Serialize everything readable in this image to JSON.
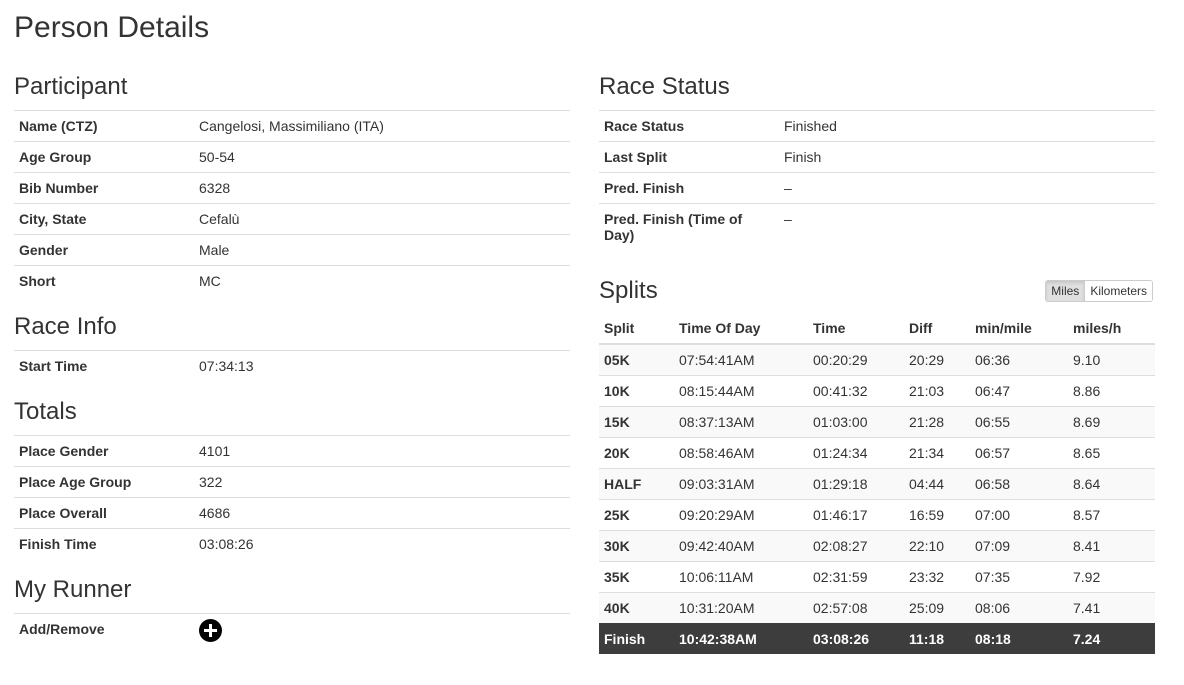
{
  "page_title": "Person Details",
  "participant": {
    "title": "Participant",
    "rows": [
      {
        "label": "Name (CTZ)",
        "value": "Cangelosi, Massimiliano (ITA)"
      },
      {
        "label": "Age Group",
        "value": "50-54"
      },
      {
        "label": "Bib Number",
        "value": "6328"
      },
      {
        "label": "City, State",
        "value": "Cefalù"
      },
      {
        "label": "Gender",
        "value": "Male"
      },
      {
        "label": "Short",
        "value": "MC"
      }
    ]
  },
  "race_info": {
    "title": "Race Info",
    "rows": [
      {
        "label": "Start Time",
        "value": "07:34:13"
      }
    ]
  },
  "totals": {
    "title": "Totals",
    "rows": [
      {
        "label": "Place Gender",
        "value": "4101"
      },
      {
        "label": "Place Age Group",
        "value": "322"
      },
      {
        "label": "Place Overall",
        "value": "4686"
      },
      {
        "label": "Finish Time",
        "value": "03:08:26"
      }
    ]
  },
  "my_runner": {
    "title": "My Runner",
    "label": "Add/Remove",
    "icon": "plus-circle-icon"
  },
  "race_status": {
    "title": "Race Status",
    "rows": [
      {
        "label": "Race Status",
        "value": "Finished"
      },
      {
        "label": "Last Split",
        "value": "Finish"
      },
      {
        "label": "Pred. Finish",
        "value": "–"
      },
      {
        "label": "Pred. Finish (Time of Day)",
        "value": "–"
      }
    ]
  },
  "splits": {
    "title": "Splits",
    "toggle": {
      "miles": "Miles",
      "kilometers": "Kilometers",
      "active": "miles"
    },
    "headers": [
      "Split",
      "Time Of Day",
      "Time",
      "Diff",
      "min/mile",
      "miles/h"
    ],
    "rows": [
      [
        "05K",
        "07:54:41AM",
        "00:20:29",
        "20:29",
        "06:36",
        "9.10"
      ],
      [
        "10K",
        "08:15:44AM",
        "00:41:32",
        "21:03",
        "06:47",
        "8.86"
      ],
      [
        "15K",
        "08:37:13AM",
        "01:03:00",
        "21:28",
        "06:55",
        "8.69"
      ],
      [
        "20K",
        "08:58:46AM",
        "01:24:34",
        "21:34",
        "06:57",
        "8.65"
      ],
      [
        "HALF",
        "09:03:31AM",
        "01:29:18",
        "04:44",
        "06:58",
        "8.64"
      ],
      [
        "25K",
        "09:20:29AM",
        "01:46:17",
        "16:59",
        "07:00",
        "8.57"
      ],
      [
        "30K",
        "09:42:40AM",
        "02:08:27",
        "22:10",
        "07:09",
        "8.41"
      ],
      [
        "35K",
        "10:06:11AM",
        "02:31:59",
        "23:32",
        "07:35",
        "7.92"
      ],
      [
        "40K",
        "10:31:20AM",
        "02:57:08",
        "25:09",
        "08:06",
        "7.41"
      ],
      [
        "Finish",
        "10:42:38AM",
        "03:08:26",
        "11:18",
        "08:18",
        "7.24"
      ]
    ],
    "highlight_color": "#3d3d3d"
  }
}
